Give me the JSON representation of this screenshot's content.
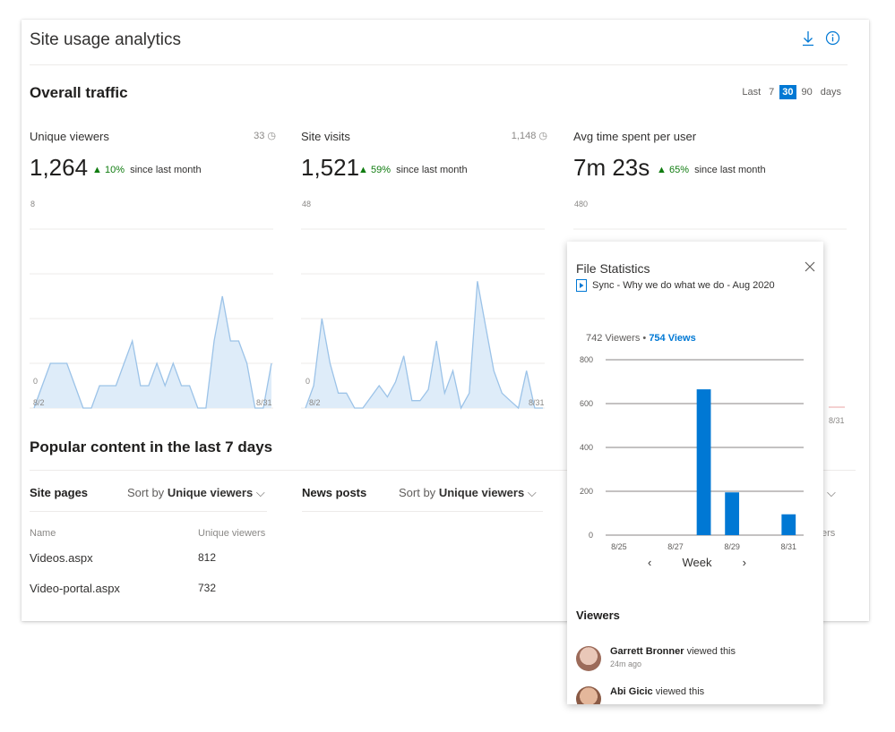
{
  "card": {
    "title": "Site usage analytics",
    "download_icon": "download-icon",
    "info_icon": "info-icon"
  },
  "traffic": {
    "title": "Overall traffic",
    "range": {
      "prefix": "Last",
      "options": [
        "7",
        "30",
        "90"
      ],
      "selected": "30",
      "suffix": "days"
    },
    "metrics": [
      {
        "label": "Unique viewers",
        "count": "33",
        "value": "1,264",
        "delta": "10%",
        "since": "since last month",
        "ymax": "8",
        "ymin": "0",
        "x_start": "8/2",
        "x_end": "8/31",
        "chart_data": {
          "type": "area",
          "x_range": [
            "8/2",
            "8/31"
          ],
          "ylim": [
            0,
            8
          ],
          "values": [
            0,
            1,
            2,
            2,
            2,
            1,
            0,
            0,
            1,
            1,
            1,
            2,
            3,
            1,
            1,
            2,
            1,
            2,
            1,
            1,
            0,
            0,
            3,
            5,
            3,
            3,
            2,
            0,
            0,
            2
          ]
        }
      },
      {
        "label": "Site visits",
        "count": "1,148",
        "value": "1,521",
        "delta": "59%",
        "since": "since last month",
        "ymax": "48",
        "ymin": "0",
        "x_start": "8/2",
        "x_end": "8/31",
        "chart_data": {
          "type": "area",
          "x_range": [
            "8/2",
            "8/31"
          ],
          "ylim": [
            0,
            48
          ],
          "values": [
            0,
            6,
            24,
            12,
            4,
            4,
            0,
            0,
            3,
            6,
            3,
            7,
            14,
            2,
            2,
            5,
            18,
            4,
            10,
            0,
            4,
            34,
            22,
            10,
            4,
            2,
            0,
            10,
            0,
            0
          ]
        }
      },
      {
        "label": "Avg time spent per user",
        "value": "7m 23s",
        "delta": "65%",
        "since": "since last month",
        "ymax": "480",
        "x_end": "8/31"
      }
    ]
  },
  "popular": {
    "title": "Popular content in the last 7 days",
    "site_pages": {
      "title": "Site pages",
      "sort_prefix": "Sort by",
      "sort_value": "Unique viewers",
      "col_name": "Name",
      "col_viewers": "Unique viewers",
      "rows": [
        {
          "name": "Videos.aspx",
          "viewers": "812"
        },
        {
          "name": "Video-portal.aspx",
          "viewers": "732"
        }
      ]
    },
    "news_posts": {
      "title": "News posts",
      "sort_prefix": "Sort by",
      "sort_value": "Unique viewers"
    },
    "third_col_clip": "ers"
  },
  "popup": {
    "title": "File Statistics",
    "file_name": "Sync - Why we do what we do - Aug 2020",
    "viewers_count": "742 Viewers",
    "separator": " • ",
    "views_count": "754 Views",
    "week_label": "Week",
    "viewers_title": "Viewers",
    "viewers": [
      {
        "name": "Garrett Bronner",
        "action": " viewed this",
        "time": "24m ago",
        "color": "#c08a7a"
      },
      {
        "name": "Abi Gicic",
        "action": " viewed this",
        "time": "",
        "color": "#b7826a"
      }
    ],
    "chart_data": {
      "type": "bar",
      "categories": [
        "8/25",
        "8/26",
        "8/27",
        "8/28",
        "8/29",
        "8/30",
        "8/31"
      ],
      "x_tick_labels": [
        "8/25",
        "8/27",
        "8/29",
        "8/31"
      ],
      "values": [
        0,
        0,
        0,
        665,
        195,
        0,
        95
      ],
      "ylim": [
        0,
        800
      ],
      "y_ticks": [
        "800",
        "600",
        "400",
        "200",
        "0"
      ],
      "grid": true
    }
  },
  "colors": {
    "accent": "#0078d4",
    "positive": "#107c10",
    "area_fill": "#deecf9",
    "area_line": "#9cc3e8"
  }
}
